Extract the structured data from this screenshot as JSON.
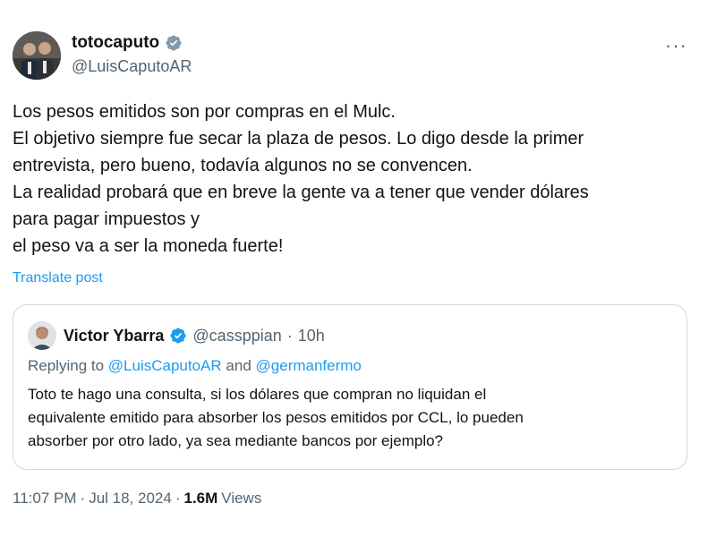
{
  "author": {
    "display_name": "totocaputo",
    "handle": "@LuisCaputoAR",
    "verified_color": "#829aab"
  },
  "menu": {
    "more_label": "···"
  },
  "tweet": {
    "lines": [
      "Los pesos emitidos son por compras en el Mulc.",
      "El objetivo siempre fue secar la plaza de pesos. Lo digo desde la primer",
      "entrevista, pero bueno, todavía algunos no se convencen.",
      "La realidad probará que en breve la gente va a tener que vender dólares",
      "para pagar impuestos y",
      "el peso va a ser la moneda fuerte!"
    ],
    "translate_label": "Translate post"
  },
  "quote": {
    "display_name": "Victor Ybarra",
    "handle": "@cassppian",
    "separator": "·",
    "time": "10h",
    "verified_color": "#1d9bf0",
    "replying_prefix": "Replying to",
    "replying_mention_1": "@LuisCaputoAR",
    "replying_and": "and",
    "replying_mention_2": "@germanfermo",
    "lines": [
      "Toto te hago una consulta, si los dólares que compran no liquidan el",
      "equivalente emitido para absorber los pesos emitidos por CCL, lo pueden",
      "absorber por otro lado, ya sea mediante bancos por ejemplo?"
    ]
  },
  "meta": {
    "time": "11:07 PM",
    "sep1": "·",
    "date": "Jul 18, 2024",
    "sep2": "·",
    "views_count": "1.6M",
    "views_label": "Views"
  }
}
